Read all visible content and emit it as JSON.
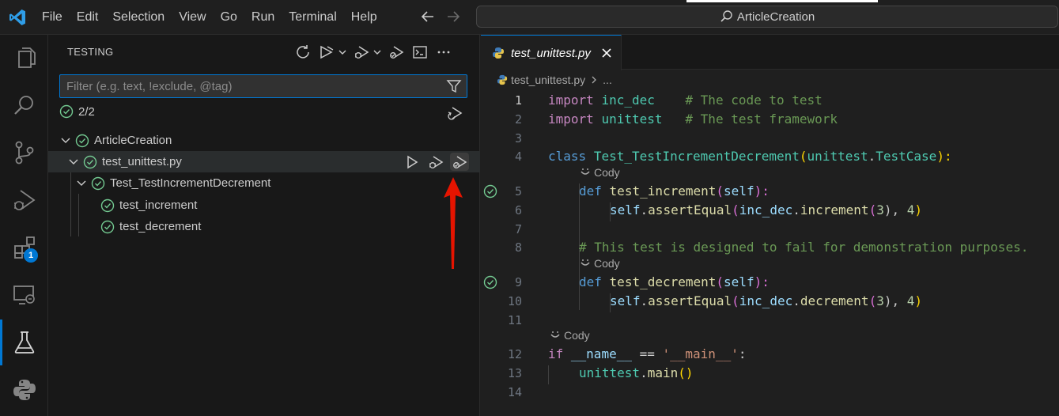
{
  "menu": [
    "File",
    "Edit",
    "Selection",
    "View",
    "Go",
    "Run",
    "Terminal",
    "Help"
  ],
  "search": {
    "text": "ArticleCreation"
  },
  "activity": {
    "extensions_badge": "1"
  },
  "sidebar": {
    "title": "TESTING",
    "filter_placeholder": "Filter (e.g. text, !exclude, @tag)",
    "result_count": "2/2",
    "tree": {
      "root": "ArticleCreation",
      "file": "test_unittest.py",
      "class": "Test_TestIncrementDecrement",
      "tests": [
        "test_increment",
        "test_decrement"
      ]
    }
  },
  "editor": {
    "tab_label": "test_unittest.py",
    "breadcrumb_file": "test_unittest.py",
    "breadcrumb_more": "...",
    "codelens": "Cody",
    "line_numbers": [
      "1",
      "2",
      "3",
      "4",
      "5",
      "6",
      "7",
      "8",
      "9",
      "10",
      "11",
      "12",
      "13",
      "14"
    ],
    "code": {
      "l1": [
        "import",
        " ",
        "inc_dec",
        "    ",
        "# The code to test"
      ],
      "l2": [
        "import",
        " ",
        "unittest",
        "   ",
        "# The test framework"
      ],
      "l4": [
        "class",
        " ",
        "Test_TestIncrementDecrement",
        "(",
        "unittest",
        ".",
        "TestCase",
        "):"
      ],
      "l5": [
        "def",
        " ",
        "test_increment",
        "(",
        "self",
        "):"
      ],
      "l6": [
        "self",
        ".",
        "assertEqual",
        "(",
        "inc_dec",
        ".",
        "increment",
        "(",
        "3",
        "), ",
        "4",
        ")"
      ],
      "l8": "# This test is designed to fail for demonstration purposes.",
      "l9": [
        "def",
        " ",
        "test_decrement",
        "(",
        "self",
        "):"
      ],
      "l10": [
        "self",
        ".",
        "assertEqual",
        "(",
        "inc_dec",
        ".",
        "decrement",
        "(",
        "3",
        "), ",
        "4",
        ")"
      ],
      "l12": [
        "if",
        " ",
        "__name__",
        " == ",
        "'__main__'",
        ":"
      ],
      "l13": [
        "unittest",
        ".",
        "main",
        "()"
      ]
    }
  },
  "colors": {
    "accent": "#0078d4",
    "pass": "#73c991",
    "annotation_arrow": "#e51400"
  }
}
